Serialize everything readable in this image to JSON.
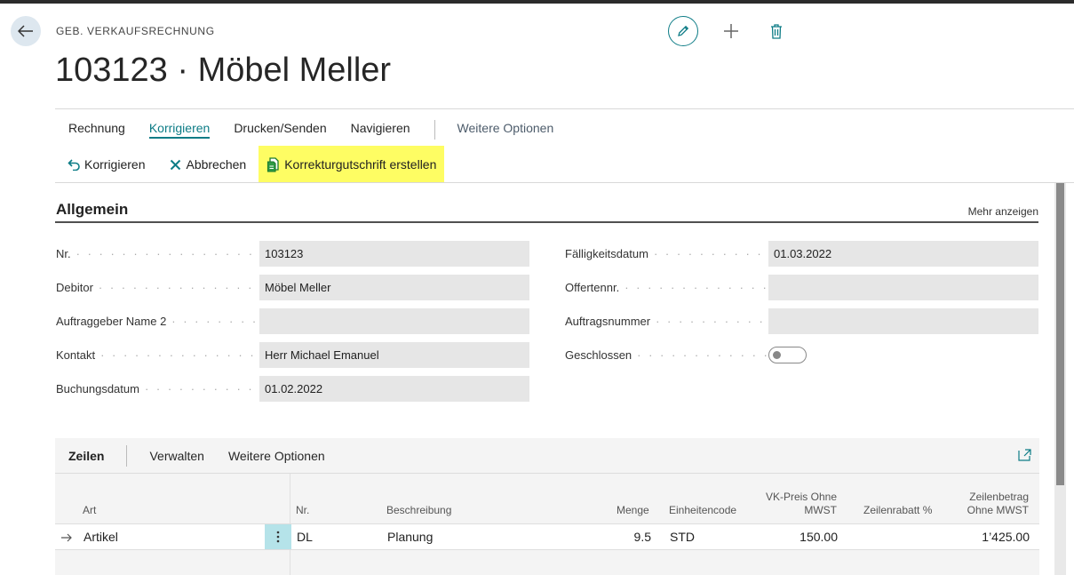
{
  "page": {
    "caption": "GEB. VERKAUFSRECHNUNG",
    "title": "103123 · Möbel Meller"
  },
  "icons": {
    "back": "arrow-left-icon",
    "edit": "pencil-icon",
    "new": "plus-icon",
    "delete": "trash-icon"
  },
  "tabs": [
    {
      "label": "Rechnung"
    },
    {
      "label": "Korrigieren",
      "active": true
    },
    {
      "label": "Drucken/Senden"
    },
    {
      "label": "Navigieren"
    },
    {
      "label": "Weitere Optionen"
    }
  ],
  "actions": [
    {
      "label": "Korrigieren",
      "icon": "undo-icon"
    },
    {
      "label": "Abbrechen",
      "icon": "close-x-icon"
    },
    {
      "label": "Korrekturgutschrift erstellen",
      "icon": "credit-memo-icon",
      "highlighted": true
    }
  ],
  "general": {
    "title": "Allgemein",
    "show_more": "Mehr anzeigen",
    "left_fields": [
      {
        "label": "Nr.",
        "value": "103123"
      },
      {
        "label": "Debitor",
        "value": "Möbel Meller"
      },
      {
        "label": "Auftraggeber Name 2",
        "value": ""
      },
      {
        "label": "Kontakt",
        "value": "Herr Michael Emanuel"
      },
      {
        "label": "Buchungsdatum",
        "value": "01.02.2022"
      }
    ],
    "right_fields": [
      {
        "label": "Fälligkeitsdatum",
        "value": "01.03.2022"
      },
      {
        "label": "Offertennr.",
        "value": ""
      },
      {
        "label": "Auftragsnummer",
        "value": ""
      },
      {
        "label": "Geschlossen",
        "toggle": false
      }
    ]
  },
  "lines": {
    "title": "Zeilen",
    "menu": [
      "Verwalten",
      "Weitere Optionen"
    ],
    "columns": {
      "art": "Art",
      "nr": "Nr.",
      "beschreibung": "Beschreibung",
      "menge": "Menge",
      "einheitencode": "Einheitencode",
      "vk_preis_1": "VK-Preis Ohne",
      "vk_preis_2": "MWST",
      "zeilenrabatt": "Zeilenrabatt %",
      "zeilenbetrag_1": "Zeilenbetrag",
      "zeilenbetrag_2": "Ohne MWST"
    },
    "rows": [
      {
        "art": "Artikel",
        "nr": "DL",
        "beschreibung": "Planung",
        "menge": "9.5",
        "einheitencode": "STD",
        "vk_preis": "150.00",
        "zeilenrabatt": "",
        "zeilenbetrag": "1’425.00"
      }
    ]
  },
  "colors": {
    "accent": "#0d7c86",
    "highlight": "#fefd63",
    "row_menu": "#b5e3e9"
  }
}
